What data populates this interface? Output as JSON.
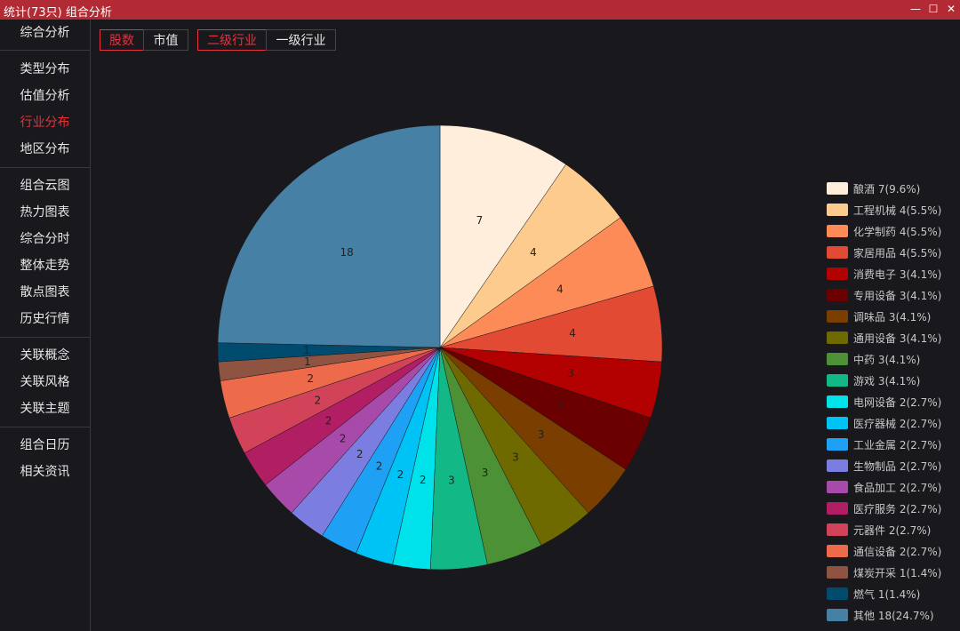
{
  "window": {
    "title": "统计(73只) 组合分析",
    "minimize_glyph": "—",
    "maximize_glyph": "☐",
    "close_glyph": "✕"
  },
  "sidebar": {
    "items": [
      {
        "label": "综合分析",
        "active": false
      },
      {
        "label": "类型分布",
        "active": false
      },
      {
        "label": "估值分析",
        "active": false
      },
      {
        "label": "行业分布",
        "active": true
      },
      {
        "label": "地区分布",
        "active": false
      },
      {
        "label": "组合云图",
        "active": false
      },
      {
        "label": "热力图表",
        "active": false
      },
      {
        "label": "综合分时",
        "active": false
      },
      {
        "label": "整体走势",
        "active": false
      },
      {
        "label": "散点图表",
        "active": false
      },
      {
        "label": "历史行情",
        "active": false
      },
      {
        "label": "关联概念",
        "active": false
      },
      {
        "label": "关联风格",
        "active": false
      },
      {
        "label": "关联主题",
        "active": false
      },
      {
        "label": "组合日历",
        "active": false
      },
      {
        "label": "相关资讯",
        "active": false
      }
    ]
  },
  "toolbar": {
    "count_label": "股数",
    "value_label": "市值",
    "level2_label": "二级行业",
    "level1_label": "一级行业"
  },
  "chart_data": {
    "type": "pie",
    "start_angle_deg": 90,
    "direction": "clockwise",
    "legend_placement": "right",
    "slices": [
      {
        "name": "酿酒",
        "value": 7,
        "legend": "酿酒 7(9.6%)",
        "color": "#ffeedb"
      },
      {
        "name": "工程机械",
        "value": 4,
        "legend": "工程机械 4(5.5%)",
        "color": "#fdcb8e"
      },
      {
        "name": "化学制药",
        "value": 4,
        "legend": "化学制药 4(5.5%)",
        "color": "#fc8b57"
      },
      {
        "name": "家居用品",
        "value": 4,
        "legend": "家居用品 4(5.5%)",
        "color": "#e34a33"
      },
      {
        "name": "消费电子",
        "value": 3,
        "legend": "消费电子 3(4.1%)",
        "color": "#b30000"
      },
      {
        "name": "专用设备",
        "value": 3,
        "legend": "专用设备 3(4.1%)",
        "color": "#6a0000"
      },
      {
        "name": "调味品",
        "value": 3,
        "legend": "调味品 3(4.1%)",
        "color": "#7a3f00"
      },
      {
        "name": "通用设备",
        "value": 3,
        "legend": "通用设备 3(4.1%)",
        "color": "#6f6a00"
      },
      {
        "name": "中药",
        "value": 3,
        "legend": "中药 3(4.1%)",
        "color": "#4c9136"
      },
      {
        "name": "游戏",
        "value": 3,
        "legend": "游戏 3(4.1%)",
        "color": "#12b886"
      },
      {
        "name": "电网设备",
        "value": 2,
        "legend": "电网设备 2(2.7%)",
        "color": "#00e2e9"
      },
      {
        "name": "医疗器械",
        "value": 2,
        "legend": "医疗器械 2(2.7%)",
        "color": "#00c3f5"
      },
      {
        "name": "工业金属",
        "value": 2,
        "legend": "工业金属 2(2.7%)",
        "color": "#1ea1f4"
      },
      {
        "name": "生物制品",
        "value": 2,
        "legend": "生物制品 2(2.7%)",
        "color": "#7c7de0"
      },
      {
        "name": "食品加工",
        "value": 2,
        "legend": "食品加工 2(2.7%)",
        "color": "#a84aa9"
      },
      {
        "name": "医疗服务",
        "value": 2,
        "legend": "医疗服务 2(2.7%)",
        "color": "#b11e63"
      },
      {
        "name": "元器件",
        "value": 2,
        "legend": "元器件 2(2.7%)",
        "color": "#d2435a"
      },
      {
        "name": "通信设备",
        "value": 2,
        "legend": "通信设备 2(2.7%)",
        "color": "#ed6a4b"
      },
      {
        "name": "煤炭开采",
        "value": 1,
        "legend": "煤炭开采 1(1.4%)",
        "color": "#8f5441"
      },
      {
        "name": "燃气",
        "value": 1,
        "legend": "燃气 1(1.4%)",
        "color": "#014b6f"
      },
      {
        "name": "其他",
        "value": 18,
        "legend": "其他 18(24.7%)",
        "color": "#4680a4"
      }
    ]
  }
}
